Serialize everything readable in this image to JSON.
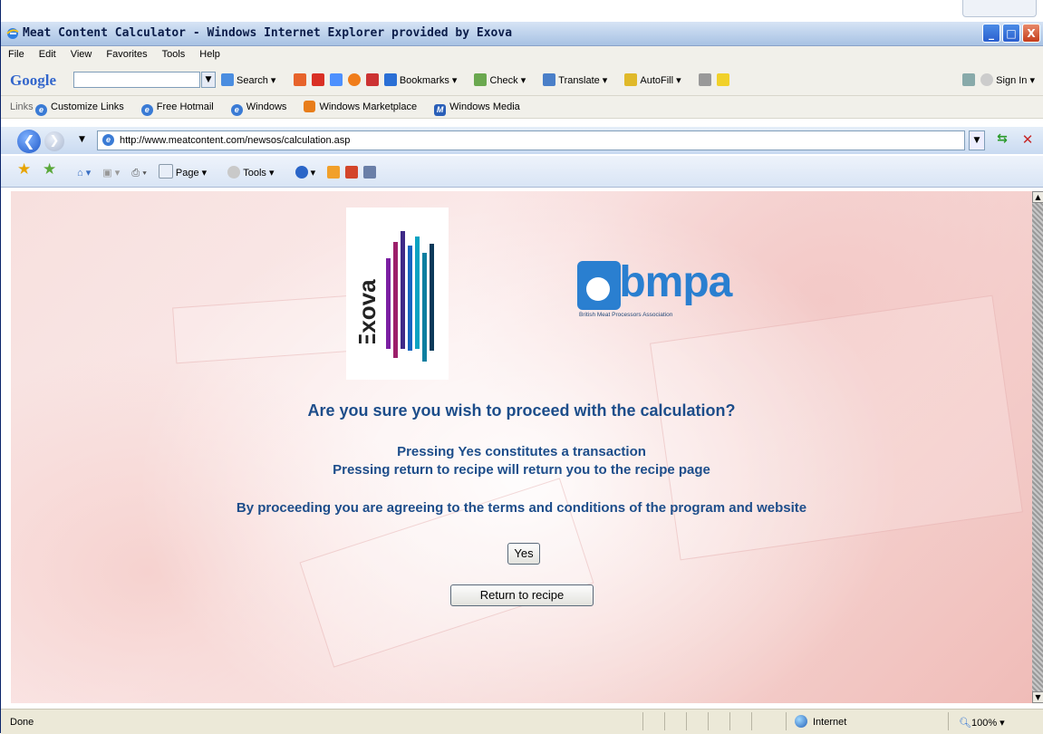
{
  "window": {
    "title": "Meat Content Calculator - Windows Internet Explorer provided by Exova",
    "buttons": {
      "minimize": "_",
      "maximize": "□",
      "close": "X"
    }
  },
  "menu": [
    "File",
    "Edit",
    "View",
    "Favorites",
    "Tools",
    "Help"
  ],
  "google_toolbar": {
    "logo": "Google",
    "search_value": "",
    "items": [
      "Search ▾",
      "Bookmarks ▾",
      "Check ▾",
      "Translate ▾",
      "AutoFill ▾"
    ],
    "sign_in": "Sign In ▾"
  },
  "links_bar": {
    "label": "Links",
    "items": [
      "Customize Links",
      "Free Hotmail",
      "Windows",
      "Windows Marketplace",
      "Windows Media"
    ]
  },
  "address": {
    "url": "http://www.meatcontent.com/newsos/calculation.asp"
  },
  "command_bar": {
    "items": [
      "Page ▾",
      "Tools ▾"
    ]
  },
  "page": {
    "logo_exova": "Exova",
    "logo_bmpa": "bmpa",
    "logo_bmpa_sub": "British Meat Processors Association",
    "question": "Are you sure you wish to proceed with the calculation?",
    "line1": "Pressing Yes constitutes a transaction",
    "line2": "Pressing return to recipe will return you to the recipe page",
    "line3": "By proceeding you are agreeing to the terms and conditions of the program and website",
    "yes_button": "Yes",
    "return_button": "Return to recipe"
  },
  "status": {
    "text": "Done",
    "zone": "Internet",
    "zoom": "100%"
  },
  "colors": {
    "heading_blue": "#1d4d8a",
    "bmpa_blue": "#2a7fd0"
  }
}
